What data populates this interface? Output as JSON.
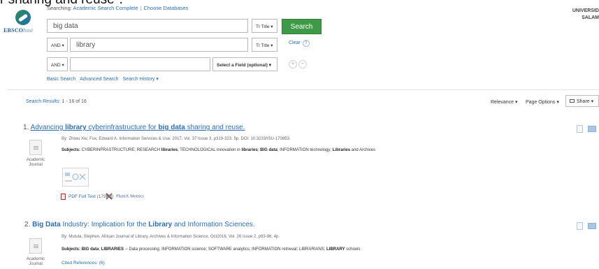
{
  "page_caption": "r sharing and reuse\".",
  "logo": {
    "brand": "EBSCO",
    "suffix": "host"
  },
  "header": {
    "searching_label": "Searching:",
    "database": "Academic Search Complete",
    "choose_databases": "Choose Databases",
    "institution_line1": "UNIVERSID",
    "institution_line2": "SALAM"
  },
  "search": {
    "row1": {
      "value": "big data",
      "field": "TI Title ▾"
    },
    "row2": {
      "bool": "AND ▾",
      "value": "library",
      "field": "TI Title ▾"
    },
    "row3": {
      "bool": "AND ▾",
      "value": "",
      "field": "Select a Field (optional) ▾"
    },
    "search_button": "Search",
    "clear_label": "Clear",
    "help": "?",
    "add": "+",
    "remove": "−",
    "links": [
      "Basic Search",
      "Advanced Search",
      "Search History ▾"
    ]
  },
  "results_bar": {
    "label": "Search Results:",
    "range": "1 - 16 of 16",
    "sort": "Relevance ▾",
    "page_options": "Page Options ▾",
    "share": "Share ▾"
  },
  "results": [
    {
      "num": "1.",
      "title_parts": [
        {
          "text": "Advancing ",
          "bold": false
        },
        {
          "text": "library",
          "bold": true
        },
        {
          "text": " cyberinfrastructure for ",
          "bold": false
        },
        {
          "text": "big data",
          "bold": true
        },
        {
          "text": " sharing and reuse.",
          "bold": false
        }
      ],
      "byline": "By: Zhiwu Xie; Fox, Edward A. Information Services & Use. 2017, Vol. 37 Issue 3, p319-323. 5p. DOI: 10.3233/ISU-170853.",
      "subjects_label": "Subjects:",
      "subjects_parts": [
        {
          "text": " CYBERINFRASTRUCTURE; RESEARCH ",
          "bold": false
        },
        {
          "text": "libraries",
          "bold": true
        },
        {
          "text": "; TECHNOLOGICAL innovation in ",
          "bold": false
        },
        {
          "text": "libraries",
          "bold": true
        },
        {
          "text": "; ",
          "bold": false
        },
        {
          "text": "BIG data",
          "bold": true
        },
        {
          "text": "; INFORMATION technology; ",
          "bold": false
        },
        {
          "text": "Libraries",
          "bold": true
        },
        {
          "text": " and Archives",
          "bold": false
        }
      ],
      "type_line1": "Academic",
      "type_line2": "Journal",
      "pdf_label": "PDF Full Text",
      "pdf_size": "(179KB)",
      "plumx": "PlumX Metrics"
    },
    {
      "num": "2.",
      "title_parts": [
        {
          "text": "Big Data",
          "bold": true
        },
        {
          "text": " Industry: Implication for the ",
          "bold": false
        },
        {
          "text": "Library",
          "bold": true
        },
        {
          "text": " and Information Sciences.",
          "bold": false
        }
      ],
      "byline": "By: Mutula, Stephen. African Journal of Library, Archives & Information Science. Oct2016, Vol. 26 Issue 2, p93-96. 4p.",
      "subjects_label": "Subjects:",
      "subjects_parts": [
        {
          "text": " ",
          "bold": false
        },
        {
          "text": "BIG data",
          "bold": true
        },
        {
          "text": "; ",
          "bold": false
        },
        {
          "text": "LIBRARIES",
          "bold": true
        },
        {
          "text": " -- Data processing; INFORMATION science; SOFTWARE analytics; INFORMATION retrieval; LIBRARIANS; ",
          "bold": false
        },
        {
          "text": "LIBRARY",
          "bold": true
        },
        {
          "text": " schools",
          "bold": false
        }
      ],
      "type_line1": "Academic",
      "type_line2": "Journal",
      "cited": "Cited References: (6)"
    }
  ],
  "colors": {
    "link": "#2a6ebb",
    "search_button": "#3f9a47"
  }
}
